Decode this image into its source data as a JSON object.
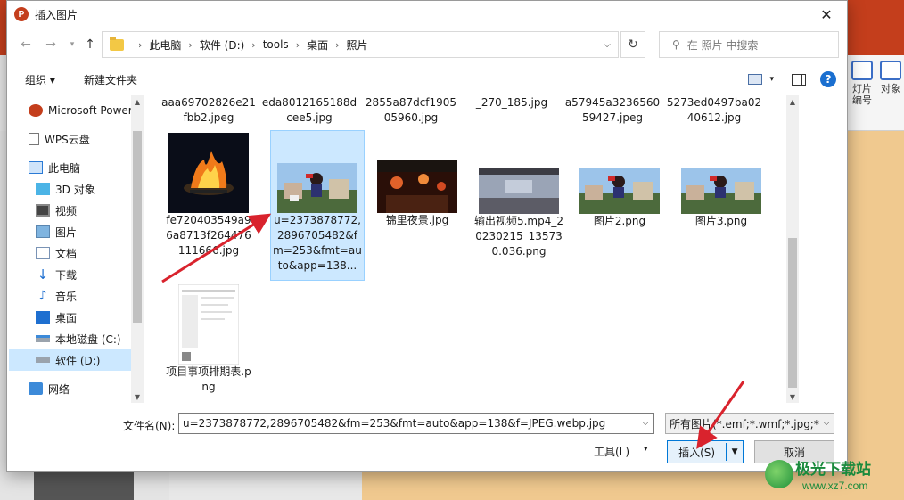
{
  "window": {
    "title": "插入图片",
    "app_icon_letter": "P",
    "close_glyph": "✕"
  },
  "nav": {
    "back": "←",
    "forward": "→",
    "up": "↑",
    "refresh": "↻"
  },
  "breadcrumb": [
    "此电脑",
    "软件 (D:)",
    "tools",
    "桌面",
    "照片"
  ],
  "search": {
    "placeholder": "在 照片 中搜索"
  },
  "toolbar": {
    "organize": "组织 ▾",
    "new_folder": "新建文件夹",
    "help": "?"
  },
  "sidebar": {
    "items": [
      {
        "label": "Microsoft Power",
        "icon": "powerpoint-icon"
      },
      {
        "label": "WPS云盘",
        "icon": "document-icon"
      },
      {
        "label": "此电脑",
        "icon": "computer-icon"
      },
      {
        "label": "3D 对象",
        "icon": "cube-icon"
      },
      {
        "label": "视频",
        "icon": "video-icon"
      },
      {
        "label": "图片",
        "icon": "picture-icon"
      },
      {
        "label": "文档",
        "icon": "document-icon"
      },
      {
        "label": "下载",
        "icon": "download-icon"
      },
      {
        "label": "音乐",
        "icon": "music-icon"
      },
      {
        "label": "桌面",
        "icon": "desktop-icon"
      },
      {
        "label": "本地磁盘 (C:)",
        "icon": "drive-icon"
      },
      {
        "label": "软件 (D:)",
        "icon": "drive-icon"
      },
      {
        "label": "网络",
        "icon": "network-icon"
      }
    ]
  },
  "files": {
    "top_row_captions": [
      "aaa69702826e21fbb2.jpeg",
      "eda8012165188dcee5.jpg",
      "2855a87dcf190505960.jpg",
      "_270_185.jpg",
      "a57945a323656059427.jpeg",
      "5273ed0497ba0240612.jpg"
    ],
    "items": [
      {
        "name": "fe720403549a96a8713f264476111666.jpg",
        "thumb": "fire"
      },
      {
        "name": "u=2373878772,2896705482&fm=253&fmt=auto&app=138...",
        "thumb": "anime"
      },
      {
        "name": "锦里夜景.jpg",
        "thumb": "night"
      },
      {
        "name": "输出视频5.mp4_20230215_135730.036.png",
        "thumb": "sky"
      },
      {
        "name": "图片2.png",
        "thumb": "anime"
      },
      {
        "name": "图片3.png",
        "thumb": "anime"
      },
      {
        "name": "项目事项排期表.png",
        "thumb": "doc"
      }
    ]
  },
  "bottom": {
    "filename_label": "文件名(N):",
    "filename_value": "u=2373878772,2896705482&fm=253&fmt=auto&app=138&f=JPEG.webp.jpg",
    "filter_value": "所有图片(*.emf;*.wmf;*.jpg;*.jp",
    "tools": "工具(L)",
    "insert": "插入(S)",
    "cancel": "取消"
  },
  "background_app": {
    "ribbon_items": [
      "灯片编号",
      "对象"
    ]
  },
  "watermark": {
    "title": "极光下载站",
    "url": "www.xz7.com"
  },
  "colors": {
    "accent": "#0078d7",
    "selection": "#cce8ff",
    "arrow": "#d9232d",
    "ppt": "#c43e1c"
  }
}
